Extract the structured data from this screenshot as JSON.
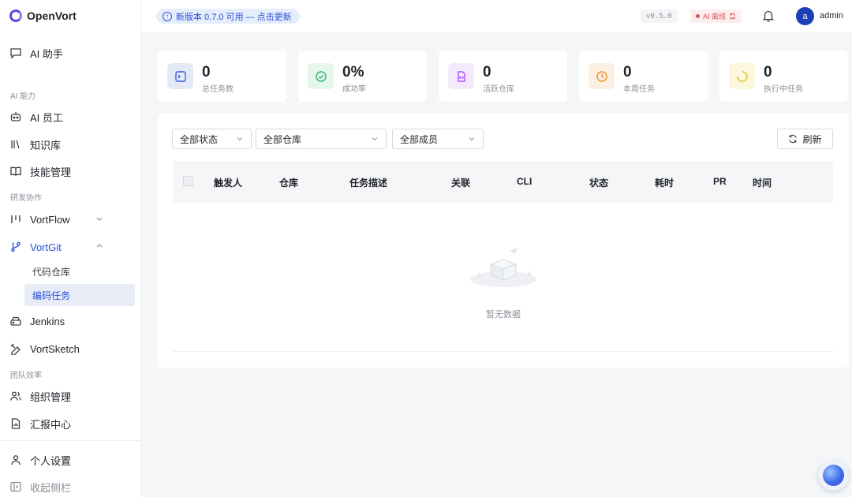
{
  "app": {
    "name": "OpenVort"
  },
  "sidebar": {
    "ai_assistant": "AI 助手",
    "sections": {
      "ai": "AI 能力",
      "dev": "研发协作",
      "team": "团队效率"
    },
    "items": {
      "ai_employee": "AI 员工",
      "knowledge": "知识库",
      "skills": "技能管理",
      "vortflow": "VortFlow",
      "vortgit": "VortGit",
      "code_repo": "代码仓库",
      "coding_tasks": "编码任务",
      "jenkins": "Jenkins",
      "vortsketch": "VortSketch",
      "org": "组织管理",
      "report": "汇报中心",
      "personal": "个人设置",
      "collapse": "收起侧栏"
    }
  },
  "header": {
    "update_notice": "新版本 0.7.0 可用 — 点击更新",
    "version": "v0.5.0",
    "ai_status": "AI 离线",
    "avatar_letter": "a",
    "username": "admin"
  },
  "stats": [
    {
      "value": "0",
      "label": "总任务数",
      "icon": "terminal-icon",
      "color": "#3b5bdb"
    },
    {
      "value": "0%",
      "label": "成功率",
      "icon": "check-circle-icon",
      "color": "#2bb673"
    },
    {
      "value": "0",
      "label": "活跃仓库",
      "icon": "code-file-icon",
      "color": "#a855f7"
    },
    {
      "value": "0",
      "label": "本周任务",
      "icon": "clock-icon",
      "color": "#f08c2e"
    },
    {
      "value": "0",
      "label": "执行中任务",
      "icon": "loading-icon",
      "color": "#e6c229"
    }
  ],
  "filters": {
    "status": "全部状态",
    "repo": "全部仓库",
    "member": "全部成员",
    "refresh": "刷新"
  },
  "table": {
    "columns": [
      "触发人",
      "仓库",
      "任务描述",
      "关联",
      "CLI",
      "状态",
      "耗时",
      "PR",
      "时间"
    ],
    "empty": "暂无数据"
  }
}
